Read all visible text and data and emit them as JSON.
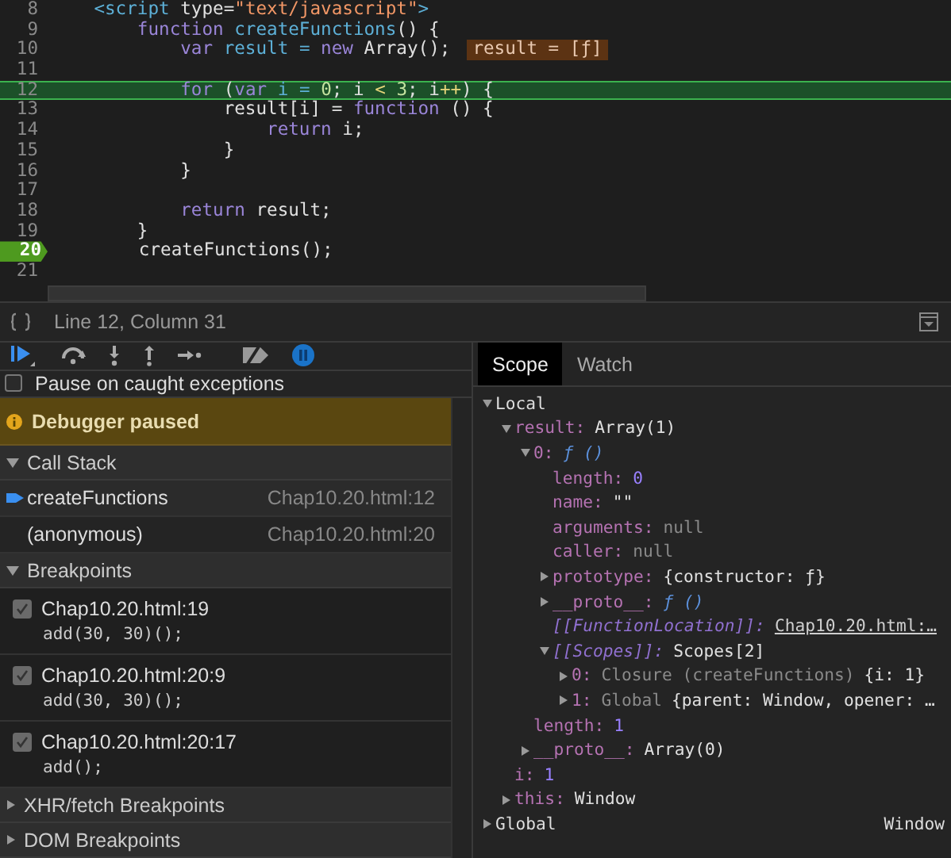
{
  "editor": {
    "lines": [
      {
        "number": "8",
        "tokens": [
          {
            "kind": "tag",
            "text": "    <script "
          },
          {
            "kind": "pl",
            "text": "type="
          },
          {
            "kind": "str",
            "text": "\"text/javascript\""
          },
          {
            "kind": "tag",
            "text": ">"
          }
        ]
      },
      {
        "number": "9",
        "tokens": [
          {
            "kind": "kw",
            "text": "        function "
          },
          {
            "kind": "fn",
            "text": "createFunctions"
          },
          {
            "kind": "pl",
            "text": "() {"
          }
        ]
      },
      {
        "number": "10",
        "tokens": [
          {
            "kind": "kw",
            "text": "            var "
          },
          {
            "kind": "fn",
            "text": "result"
          },
          {
            "kind": "fn",
            "text": " = "
          },
          {
            "kind": "kw",
            "text": "new "
          },
          {
            "kind": "pl",
            "text": "Array();"
          }
        ],
        "inline_value": "result = [ƒ]"
      },
      {
        "number": "11"
      },
      {
        "number": "12",
        "current": true,
        "tokens": [
          {
            "kind": "kw",
            "text": "            for "
          },
          {
            "kind": "pl",
            "text": "("
          },
          {
            "kind": "kw",
            "text": "var "
          },
          {
            "kind": "fn",
            "text": "i"
          },
          {
            "kind": "fn",
            "text": " = "
          },
          {
            "kind": "num",
            "text": "0"
          },
          {
            "kind": "pl",
            "text": "; i "
          },
          {
            "kind": "op",
            "text": "<"
          },
          {
            "kind": "num",
            "text": " 3"
          },
          {
            "kind": "pl",
            "text": "; i"
          },
          {
            "kind": "op",
            "text": "++"
          },
          {
            "kind": "pl",
            "text": ") {"
          }
        ]
      },
      {
        "number": "13",
        "tokens": [
          {
            "kind": "pl",
            "text": "                result[i] = "
          },
          {
            "kind": "kw",
            "text": "function "
          },
          {
            "kind": "pl",
            "text": "() {"
          }
        ]
      },
      {
        "number": "14",
        "tokens": [
          {
            "kind": "kw",
            "text": "                    return "
          },
          {
            "kind": "pl",
            "text": "i;"
          }
        ]
      },
      {
        "number": "15",
        "tokens": [
          {
            "kind": "pl",
            "text": "                }"
          }
        ]
      },
      {
        "number": "16",
        "tokens": [
          {
            "kind": "pl",
            "text": "            }"
          }
        ]
      },
      {
        "number": "17"
      },
      {
        "number": "18",
        "tokens": [
          {
            "kind": "kw",
            "text": "            return "
          },
          {
            "kind": "pl",
            "text": "result;"
          }
        ]
      },
      {
        "number": "19",
        "tokens": [
          {
            "kind": "pl",
            "text": "        }"
          }
        ]
      },
      {
        "number": "20",
        "breakpoint": true,
        "tokens": [
          {
            "kind": "pl",
            "text": "        createFunctions();"
          }
        ]
      },
      {
        "number": "21"
      }
    ]
  },
  "status_bar": {
    "position": "Line 12, Column 31"
  },
  "pause_on_caught_exceptions": {
    "label": "Pause on caught exceptions",
    "checked": false
  },
  "paused_banner": {
    "text": "Debugger paused"
  },
  "call_stack": {
    "title": "Call Stack",
    "expanded": true,
    "frames": [
      {
        "name": "createFunctions",
        "location": "Chap10.20.html:12",
        "selected": true
      },
      {
        "name": "(anonymous)",
        "location": "Chap10.20.html:20",
        "selected": false
      }
    ]
  },
  "breakpoints": {
    "title": "Breakpoints",
    "expanded": true,
    "items": [
      {
        "location": "Chap10.20.html:19",
        "code": "add(30, 30)();",
        "checked": true
      },
      {
        "location": "Chap10.20.html:20:9",
        "code": "add(30, 30)();",
        "checked": true
      },
      {
        "location": "Chap10.20.html:20:17",
        "code": "add();",
        "checked": true
      }
    ]
  },
  "collapsed_sections": [
    {
      "title": "XHR/fetch Breakpoints",
      "expanded": false
    },
    {
      "title": "DOM Breakpoints",
      "expanded": false
    }
  ],
  "scope": {
    "tabs": [
      {
        "label": "Scope",
        "selected": true
      },
      {
        "label": "Watch",
        "selected": false
      }
    ],
    "tree": [
      {
        "name": "Local",
        "kind": "scope",
        "expanded": true,
        "children": [
          {
            "name": "result:",
            "value": "Array(1)",
            "kind": "obj",
            "expanded": true,
            "children": [
              {
                "name": "0:",
                "value": "ƒ ()",
                "kind": "fn",
                "expanded": true,
                "children": [
                  {
                    "name": "length:",
                    "value": "0",
                    "kind": "num"
                  },
                  {
                    "name": "name:",
                    "value": "\"\"",
                    "kind": "str"
                  },
                  {
                    "name": "arguments:",
                    "value": "null",
                    "kind": "null"
                  },
                  {
                    "name": "caller:",
                    "value": "null",
                    "kind": "null"
                  },
                  {
                    "name": "prototype:",
                    "value": "{constructor: ƒ}",
                    "kind": "obj",
                    "expanded": false
                  },
                  {
                    "name": "__proto__:",
                    "value": "ƒ ()",
                    "kind": "fn",
                    "expanded": false
                  },
                  {
                    "name": "[[FunctionLocation]]:",
                    "internal": true,
                    "value": "Chap10.20.html:…",
                    "kind": "link"
                  },
                  {
                    "name": "[[Scopes]]:",
                    "internal": true,
                    "value": "Scopes[2]",
                    "kind": "obj",
                    "expanded": true,
                    "children": [
                      {
                        "name": "0:",
                        "note": "Closure (createFunctions)",
                        "value": "{i: 1}",
                        "kind": "obj",
                        "expanded": false
                      },
                      {
                        "name": "1:",
                        "note": "Global",
                        "value": "{parent: Window, opener: …",
                        "kind": "obj",
                        "expanded": false
                      }
                    ]
                  }
                ]
              },
              {
                "name": "length:",
                "value": "1",
                "kind": "num"
              },
              {
                "name": "__proto__:",
                "value": "Array(0)",
                "kind": "obj",
                "expanded": false
              }
            ]
          },
          {
            "name": "i:",
            "value": "1",
            "kind": "num"
          },
          {
            "name": "this:",
            "value": "Window",
            "kind": "obj",
            "expanded": false
          }
        ]
      },
      {
        "name": "Global",
        "kind": "scope",
        "value": "Window",
        "expanded": false
      }
    ]
  }
}
